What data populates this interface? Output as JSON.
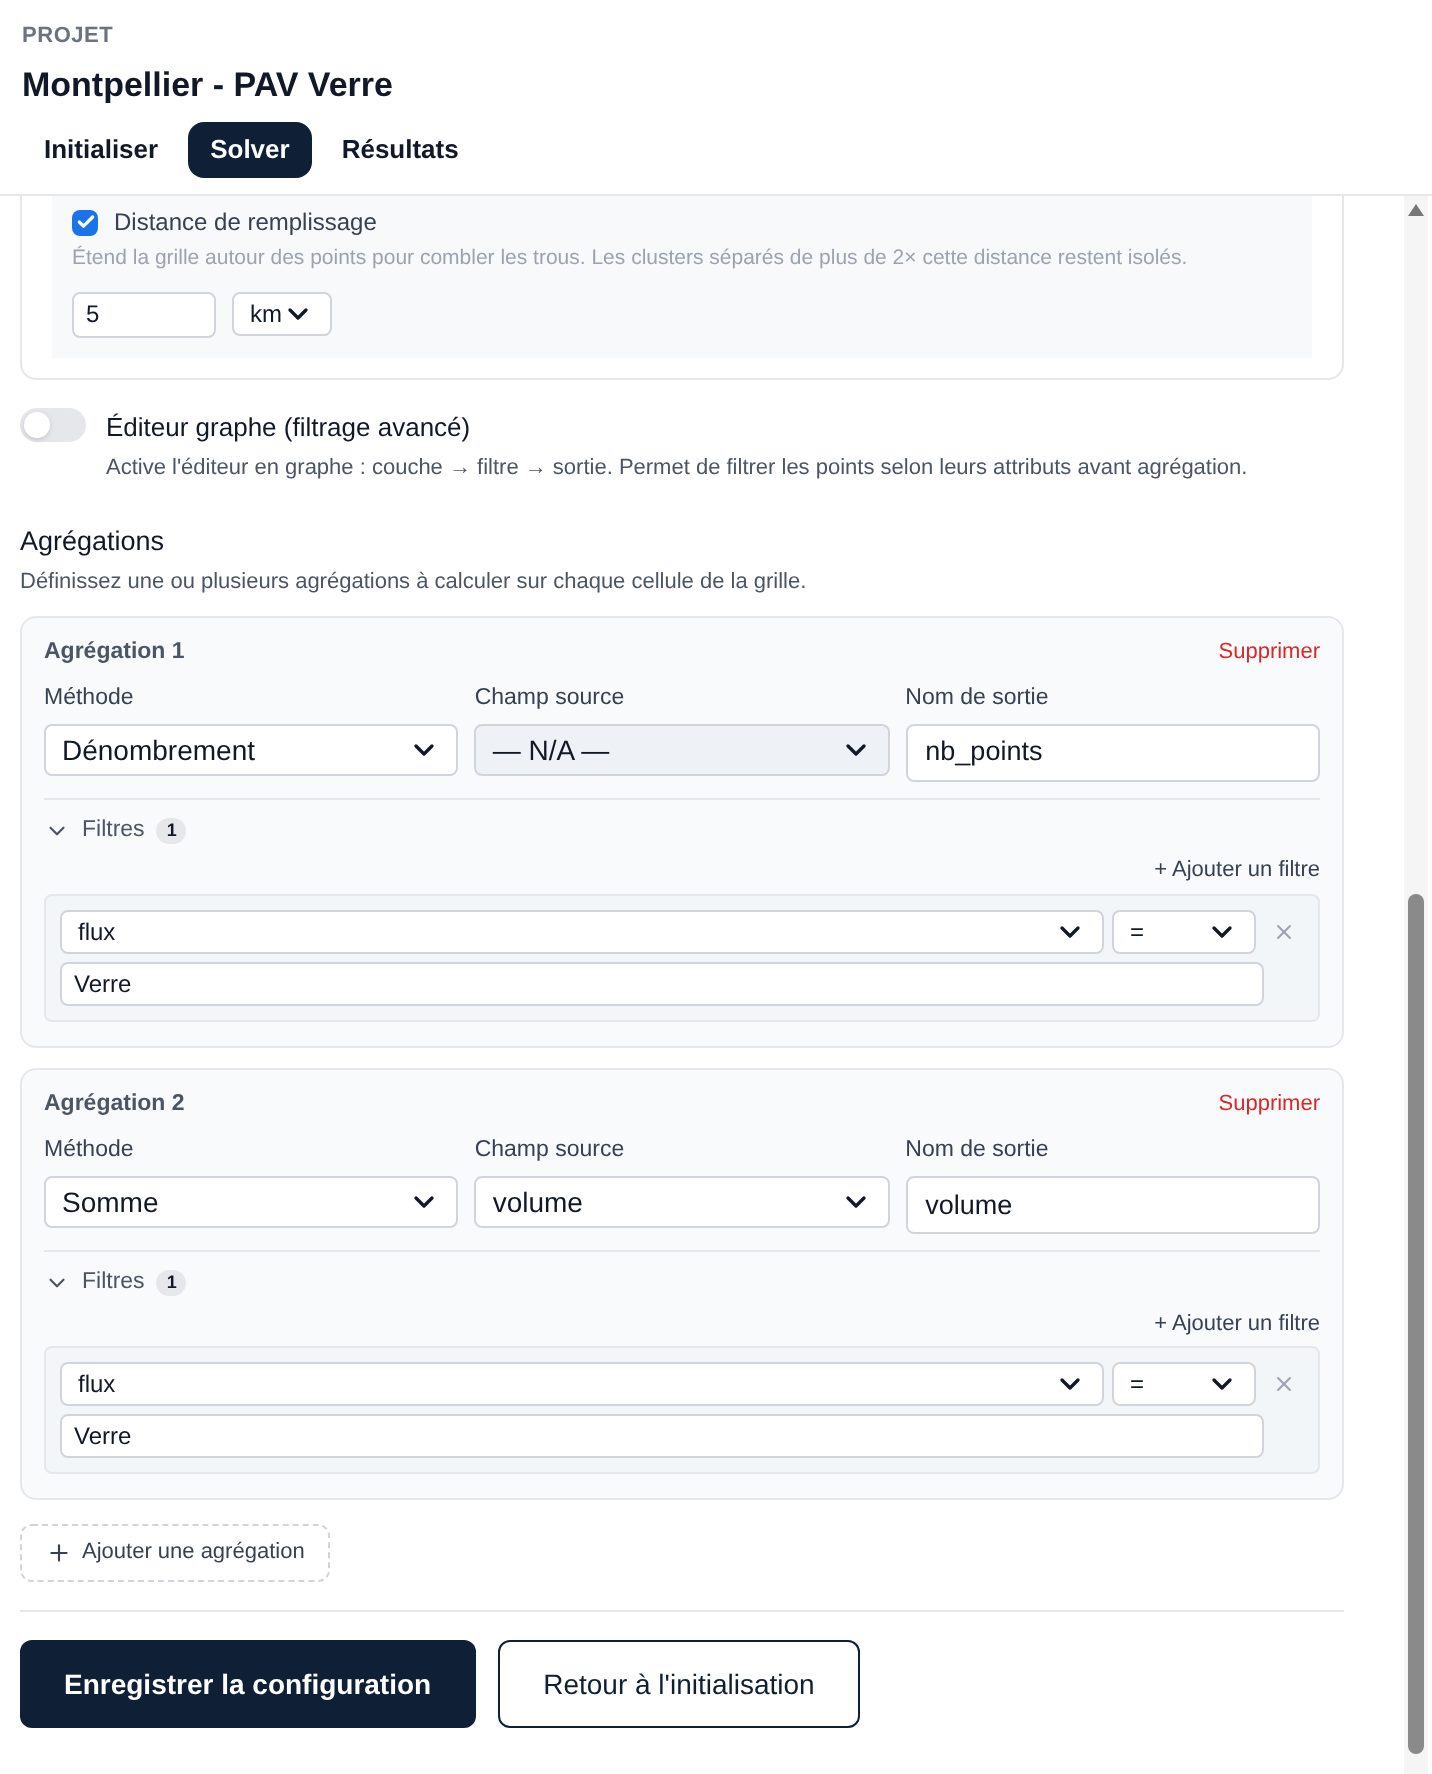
{
  "header": {
    "eyebrow": "PROJET",
    "title": "Montpellier - PAV Verre"
  },
  "tabs": [
    {
      "label": "Initialiser",
      "selected": false
    },
    {
      "label": "Solver",
      "selected": true
    },
    {
      "label": "Résultats",
      "selected": false
    }
  ],
  "fill_distance": {
    "label": "Distance de remplissage",
    "checked": true,
    "help": "Étend la grille autour des points pour combler les trous. Les clusters séparés de plus de 2× cette distance restent isolés.",
    "value": "5",
    "unit": "km"
  },
  "graph_editor": {
    "label": "Éditeur graphe (filtrage avancé)",
    "on": false,
    "help": "Active l'éditeur en graphe : couche → filtre → sortie. Permet de filtrer les points selon leurs attributs avant agrégation."
  },
  "aggregations": {
    "title": "Agrégations",
    "subtitle": "Définissez une ou plusieurs agrégations à calculer sur chaque cellule de la grille.",
    "items": [
      {
        "title": "Agrégation 1",
        "delete": "Supprimer",
        "method_label": "Méthode",
        "method": "Dénombrement",
        "source_label": "Champ source",
        "source": "— N/A —",
        "source_disabled": true,
        "output_label": "Nom de sortie",
        "output": "nb_points",
        "filters_label": "Filtres",
        "filters_expanded": true,
        "filters_count": "1",
        "add_filter": "+ Ajouter un filtre",
        "filters": [
          {
            "field": "flux",
            "operator": "=",
            "value": "Verre"
          }
        ]
      },
      {
        "title": "Agrégation 2",
        "delete": "Supprimer",
        "method_label": "Méthode",
        "method": "Somme",
        "source_label": "Champ source",
        "source": "volume",
        "source_disabled": false,
        "output_label": "Nom de sortie",
        "output": "volume",
        "filters_label": "Filtres",
        "filters_expanded": true,
        "filters_count": "1",
        "add_filter": "+ Ajouter un filtre",
        "filters": [
          {
            "field": "flux",
            "operator": "=",
            "value": "Verre"
          }
        ]
      }
    ],
    "add": "Ajouter une agrégation"
  },
  "buttons": [
    {
      "label": "Enregistrer la configuration",
      "kind": "primary"
    },
    {
      "label": "Retour à l'initialisation",
      "kind": "secondary"
    }
  ]
}
